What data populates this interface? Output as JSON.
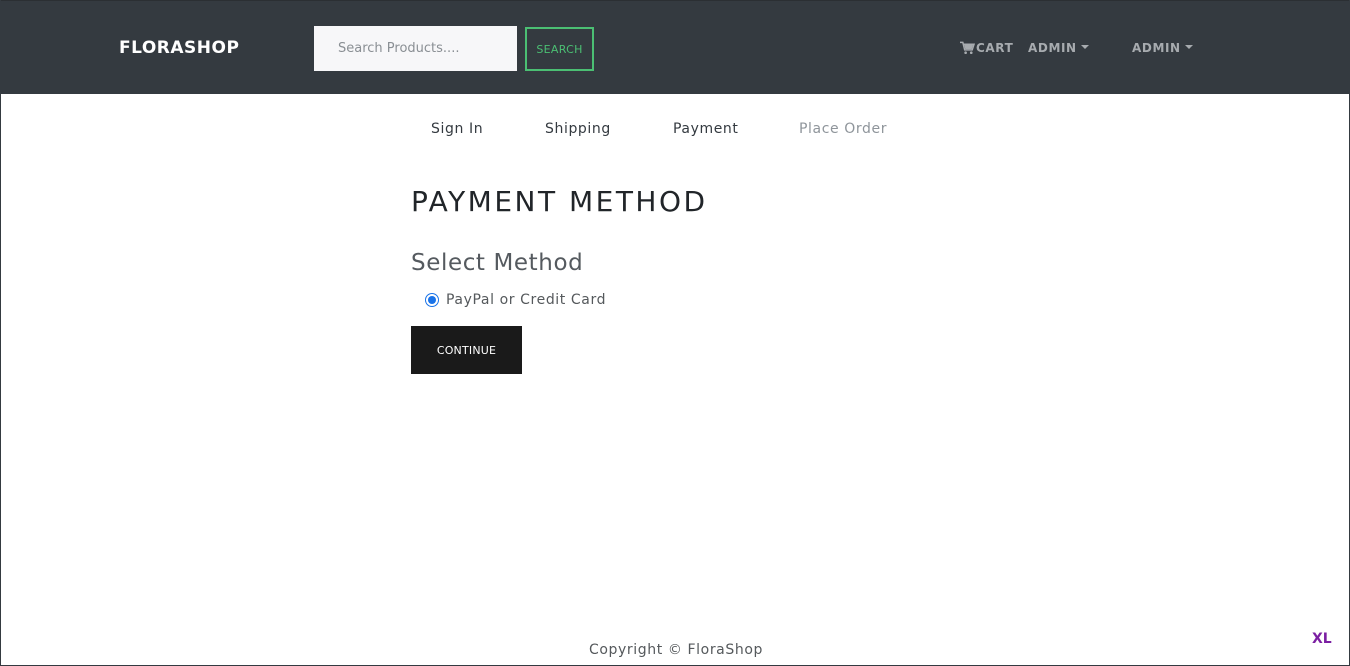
{
  "navbar": {
    "brand": "FLORASHOP",
    "search": {
      "placeholder": "Search Products....",
      "value": "",
      "button_label": "SEARCH"
    },
    "links": {
      "cart": {
        "label": "CART",
        "icon": "cart-icon"
      },
      "user_menu": {
        "label": "ADMIN",
        "icon": "chevron-down-icon"
      },
      "admin_menu": {
        "label": "ADMIN",
        "icon": "chevron-down-icon"
      }
    }
  },
  "steps": [
    {
      "label": "Sign In",
      "enabled": true
    },
    {
      "label": "Shipping",
      "enabled": true
    },
    {
      "label": "Payment",
      "enabled": true
    },
    {
      "label": "Place Order",
      "enabled": false
    }
  ],
  "form": {
    "title": "PAYMENT METHOD",
    "section_label": "Select Method",
    "options": [
      {
        "label": "PayPal or Credit Card",
        "selected": true
      }
    ],
    "submit_label": "CONTINUE"
  },
  "footer": {
    "copyright": "Copyright © FloraShop"
  },
  "corner_badge": "XL",
  "colors": {
    "navbar_bg": "#343a40",
    "search_accent": "#4bbf73",
    "radio_accent": "#1a73e8",
    "button_bg": "#1a1a1a",
    "badge": "#7b1fa2"
  }
}
